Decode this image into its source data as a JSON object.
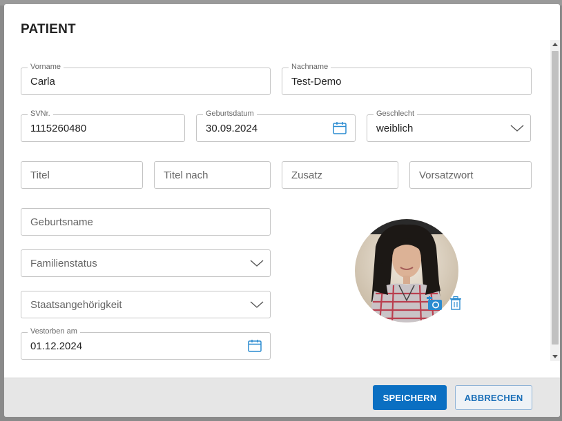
{
  "dialog": {
    "title": "PATIENT"
  },
  "fields": {
    "vorname": {
      "label": "Vorname",
      "value": "Carla"
    },
    "nachname": {
      "label": "Nachname",
      "value": "Test-Demo"
    },
    "svnr": {
      "label": "SVNr.",
      "value": "1115260480"
    },
    "geburtsdatum": {
      "label": "Geburtsdatum",
      "value": "30.09.2024"
    },
    "geschlecht": {
      "label": "Geschlecht",
      "value": "weiblich"
    },
    "titel": {
      "placeholder": "Titel"
    },
    "titel_nach": {
      "placeholder": "Titel nach"
    },
    "zusatz": {
      "placeholder": "Zusatz"
    },
    "vorsatzwort": {
      "placeholder": "Vorsatzwort"
    },
    "geburtsname": {
      "placeholder": "Geburtsname"
    },
    "familienstatus": {
      "placeholder": "Familienstatus"
    },
    "staatsangehoerigkeit": {
      "placeholder": "Staatsangehörigkeit"
    },
    "verstorben": {
      "label": "Vestorben am",
      "value": "01.12.2024"
    }
  },
  "photo": {
    "upload_icon": "camera-icon",
    "delete_icon": "trash-icon"
  },
  "footer": {
    "save_label": "SPEICHERN",
    "cancel_label": "ABBRECHEN"
  },
  "colors": {
    "accent": "#0a6fc2",
    "icon": "#2a8bd0"
  }
}
